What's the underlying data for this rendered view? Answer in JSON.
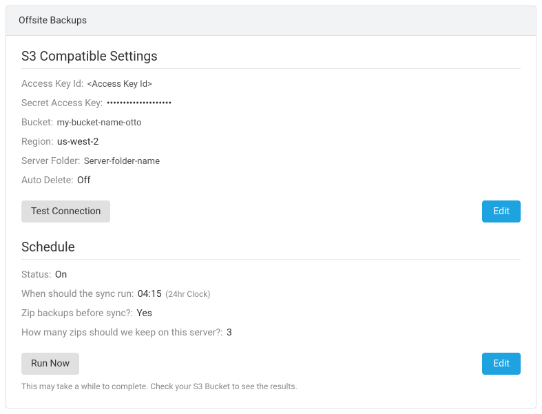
{
  "panel": {
    "title": "Offsite Backups"
  },
  "s3": {
    "heading": "S3 Compatible Settings",
    "access_key_label": "Access Key Id:",
    "access_key_value": "<Access Key Id>",
    "secret_label": "Secret Access Key:",
    "secret_value": "••••••••••••••••••••",
    "bucket_label": "Bucket:",
    "bucket_value": "my-bucket-name-otto",
    "region_label": "Region:",
    "region_value": "us-west-2",
    "folder_label": "Server Folder:",
    "folder_value": "Server-folder-name",
    "auto_delete_label": "Auto Delete:",
    "auto_delete_value": "Off",
    "test_button": "Test Connection",
    "edit_button": "Edit"
  },
  "schedule": {
    "heading": "Schedule",
    "status_label": "Status:",
    "status_value": "On",
    "when_label": "When should the sync run:",
    "when_value": "04:15",
    "when_note": "(24hr Clock)",
    "zip_label": "Zip backups before sync?:",
    "zip_value": "Yes",
    "keep_label": "How many zips should we keep on this server?:",
    "keep_value": "3",
    "run_button": "Run Now",
    "edit_button": "Edit",
    "footnote": "This may take a while to complete. Check your S3 Bucket to see the results."
  }
}
